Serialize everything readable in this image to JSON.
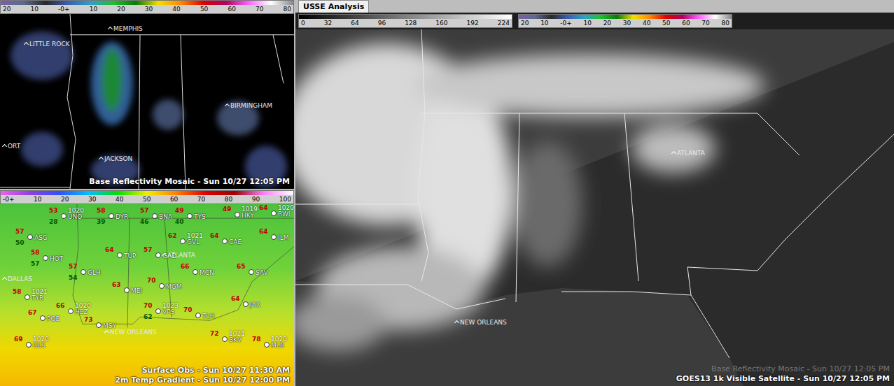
{
  "radar_panel": {
    "colorbar": [
      "20",
      "10",
      "-0+",
      "10",
      "20",
      "30",
      "40",
      "50",
      "60",
      "70",
      "80"
    ],
    "cities": [
      "MEMPHIS",
      "LITTLE ROCK",
      "BIRMINGHAM",
      "JACKSON",
      "ORT"
    ],
    "caption": "Base Reflectivity Mosaic - Sun 10/27 12:05 PM"
  },
  "surface_panel": {
    "colorbar": [
      "-0+",
      "10",
      "20",
      "30",
      "40",
      "50",
      "60",
      "70",
      "80",
      "90",
      "100"
    ],
    "stations": [
      {
        "id": "UNO",
        "temp": "53",
        "dew": "28",
        "pres": "1020"
      },
      {
        "id": "DYR",
        "temp": "58",
        "dew": "39"
      },
      {
        "id": "BNA",
        "temp": "57",
        "dew": "46"
      },
      {
        "id": "TYS",
        "temp": "49",
        "dew": "40"
      },
      {
        "id": "HKY",
        "temp": "49",
        "pres": "1019"
      },
      {
        "id": "RWI",
        "temp": "64",
        "pres": "1020"
      },
      {
        "id": "ASG",
        "temp": "57",
        "dew": "50"
      },
      {
        "id": "ILM",
        "temp": "64"
      },
      {
        "id": "GVL",
        "temp": "62",
        "pres": "1021"
      },
      {
        "id": "CAE",
        "temp": "64"
      },
      {
        "id": "HOT",
        "temp": "58",
        "dew": "57"
      },
      {
        "id": "TUP",
        "temp": "64"
      },
      {
        "id": "GAD",
        "temp": "57"
      },
      {
        "id": "MCN",
        "temp": "66"
      },
      {
        "id": "SAV",
        "temp": "65"
      },
      {
        "id": "GLH",
        "temp": "57",
        "dew": "54"
      },
      {
        "id": "MEI",
        "temp": "63"
      },
      {
        "id": "MGM",
        "temp": "70"
      },
      {
        "id": "TYR",
        "temp": "58",
        "pres": "1021"
      },
      {
        "id": "HEZ",
        "temp": "66",
        "pres": "1020"
      },
      {
        "id": "POE",
        "temp": "67"
      },
      {
        "id": "VPS",
        "temp": "70",
        "dew": "62",
        "pres": "1023"
      },
      {
        "id": "TLH",
        "temp": "70"
      },
      {
        "id": "JAX",
        "temp": "64"
      },
      {
        "id": "MSY",
        "temp": "73"
      },
      {
        "id": "GLS",
        "temp": "69",
        "pres": "1020"
      },
      {
        "id": "BKV",
        "temp": "72",
        "pres": "1021"
      },
      {
        "id": "MLB",
        "temp": "78",
        "pres": "1020"
      }
    ],
    "cities": [
      "ATLANTA",
      "NEW ORLEANS",
      "DALLAS"
    ],
    "captions": [
      "Surface Obs - Sun 10/27 11:30 AM",
      "2m Temp Gradient - Sun 10/27 12:00 PM"
    ]
  },
  "satellite_panel": {
    "tab": {
      "label": "USSE Analysis",
      "selected": true
    },
    "grayscale_bar": [
      "0",
      "32",
      "64",
      "96",
      "128",
      "160",
      "192",
      "224"
    ],
    "reflectivity_bar": [
      "20",
      "10",
      "-0+",
      "10",
      "20",
      "30",
      "40",
      "50",
      "60",
      "70",
      "80"
    ],
    "cities": [
      "ATLANTA",
      "NEW ORLEANS"
    ],
    "captions": [
      "Base Reflectivity Mosaic - Sun 10/27 12:05 PM",
      "GOES13 1k Visible Satellite - Sun 10/27 12:05 PM"
    ]
  }
}
